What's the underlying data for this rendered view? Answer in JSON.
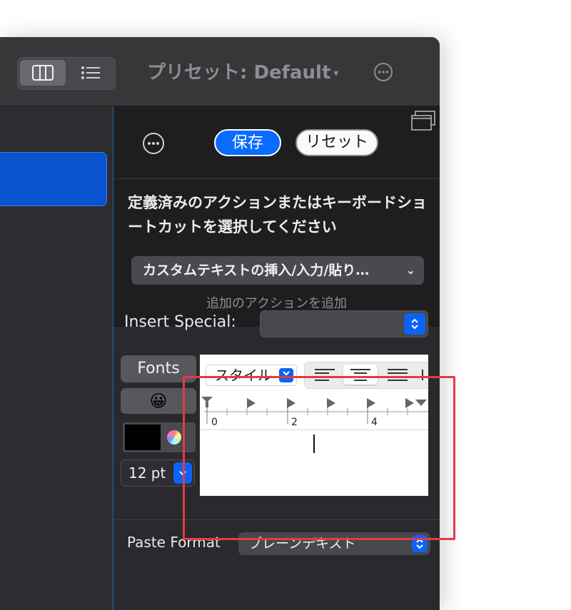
{
  "toolbar": {
    "preset_title": "プリセット: Default",
    "preset_caret": "▾"
  },
  "panel": {
    "save_label": "保存",
    "reset_label": "リセット",
    "prompt": "定義済みのアクションまたはキーボードショートカットを選択してください",
    "action_popup": "カスタムテキストの挿入/入力/貼り…",
    "action_chevron": "⌄",
    "add_action": "追加のアクションを追加",
    "insert_special_label": "Insert Special:",
    "fonts_label": "Fonts",
    "emoji": "😀",
    "font_size": "12 pt",
    "paste_format_label": "Paste Format",
    "paste_format_value": "プレーンテキスト"
  },
  "editor": {
    "style_label": "スタイル",
    "ruler_labels": [
      "0",
      "2",
      "4"
    ]
  },
  "colors": {
    "accent": "#0a6cff",
    "highlight_box": "#e63946",
    "text_color_swatch": "#000000"
  }
}
